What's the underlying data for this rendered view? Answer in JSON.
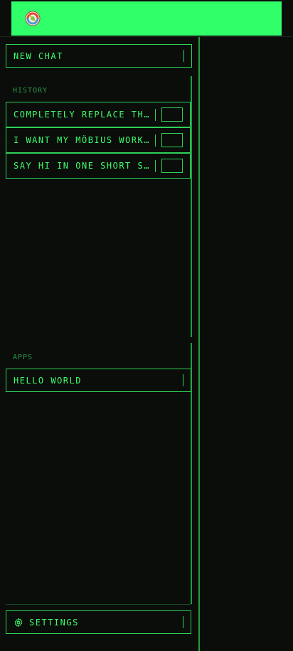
{
  "header": {
    "logo_icon": "rainbow-swirl-logo-icon",
    "bar_color": "#30ff6a"
  },
  "sidebar": {
    "new_chat_label": "NEW CHAT",
    "history_title": "HISTORY",
    "history": [
      {
        "label": "COMPLETELY REPLACE THE CHAT"
      },
      {
        "label": "I WANT MY MÖBIUS WORKSPACE"
      },
      {
        "label": "SAY HI IN ONE SHORT SENTENCE"
      }
    ],
    "apps_title": "APPS",
    "apps": [
      {
        "label": "HELLO WORLD"
      }
    ],
    "settings_label": "SETTINGS"
  },
  "theme": {
    "accent": "#3bff6a",
    "background": "#0b0d0b",
    "border": "#2fd157"
  }
}
